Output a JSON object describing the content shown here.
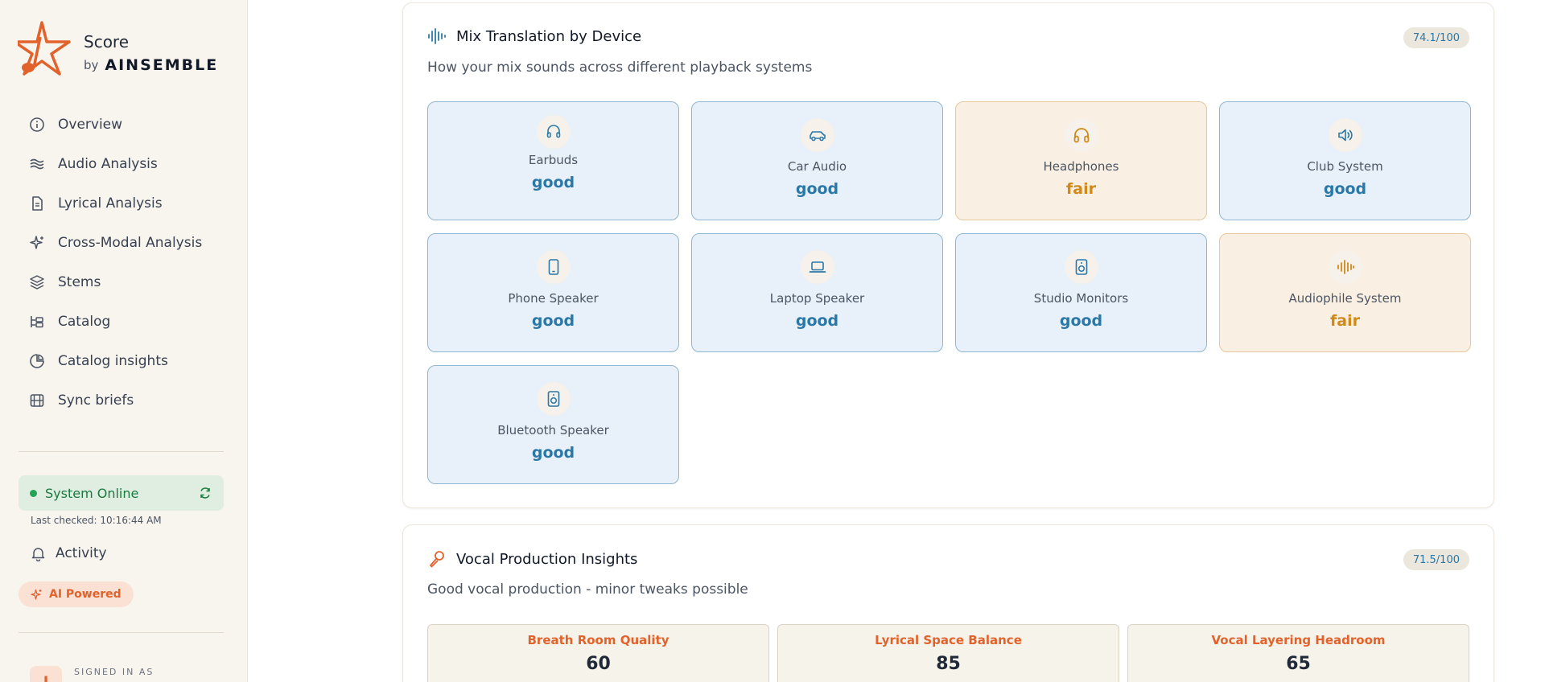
{
  "brand": {
    "title": "Score",
    "by": "by",
    "company": "AINSEMBLE"
  },
  "nav": {
    "items": [
      {
        "label": "Overview",
        "icon": "info-icon"
      },
      {
        "label": "Audio Analysis",
        "icon": "waves-icon"
      },
      {
        "label": "Lyrical Analysis",
        "icon": "document-icon"
      },
      {
        "label": "Cross-Modal Analysis",
        "icon": "sparkle-icon"
      },
      {
        "label": "Stems",
        "icon": "layers-icon"
      },
      {
        "label": "Catalog",
        "icon": "catalog-icon"
      },
      {
        "label": "Catalog insights",
        "icon": "pie-chart-icon"
      },
      {
        "label": "Sync briefs",
        "icon": "film-icon"
      }
    ]
  },
  "system": {
    "status": "System Online",
    "last_checked": "Last checked: 10:16:44 AM",
    "status_color": "#22a356"
  },
  "activity": {
    "label": "Activity"
  },
  "ai_badge": {
    "label": "AI Powered"
  },
  "user": {
    "signed_in_label": "SIGNED IN AS",
    "initial": "J"
  },
  "mix_translation": {
    "title": "Mix Translation by Device",
    "score": "74.1/100",
    "subtitle": "How your mix sounds across different playback systems",
    "devices": [
      {
        "name": "Earbuds",
        "status": "good",
        "icon": "earbuds-icon"
      },
      {
        "name": "Car Audio",
        "status": "good",
        "icon": "car-icon"
      },
      {
        "name": "Headphones",
        "status": "fair",
        "icon": "headphones-icon"
      },
      {
        "name": "Club System",
        "status": "good",
        "icon": "speaker-volume-icon"
      },
      {
        "name": "Phone Speaker",
        "status": "good",
        "icon": "phone-icon"
      },
      {
        "name": "Laptop Speaker",
        "status": "good",
        "icon": "laptop-icon"
      },
      {
        "name": "Studio Monitors",
        "status": "good",
        "icon": "studio-speaker-icon"
      },
      {
        "name": "Audiophile System",
        "status": "fair",
        "icon": "audio-waveform-icon"
      },
      {
        "name": "Bluetooth Speaker",
        "status": "good",
        "icon": "bluetooth-speaker-icon"
      }
    ]
  },
  "vocal": {
    "title": "Vocal Production Insights",
    "score": "71.5/100",
    "subtitle": "Good vocal production - minor tweaks possible",
    "metrics": [
      {
        "label": "Breath Room Quality",
        "value": "60"
      },
      {
        "label": "Lyrical Space Balance",
        "value": "85"
      },
      {
        "label": "Vocal Layering Headroom",
        "value": "65"
      }
    ]
  },
  "colors": {
    "accent_orange": "#e2622b",
    "good_blue": "#2a78a8",
    "fair_amber": "#d1891a"
  }
}
